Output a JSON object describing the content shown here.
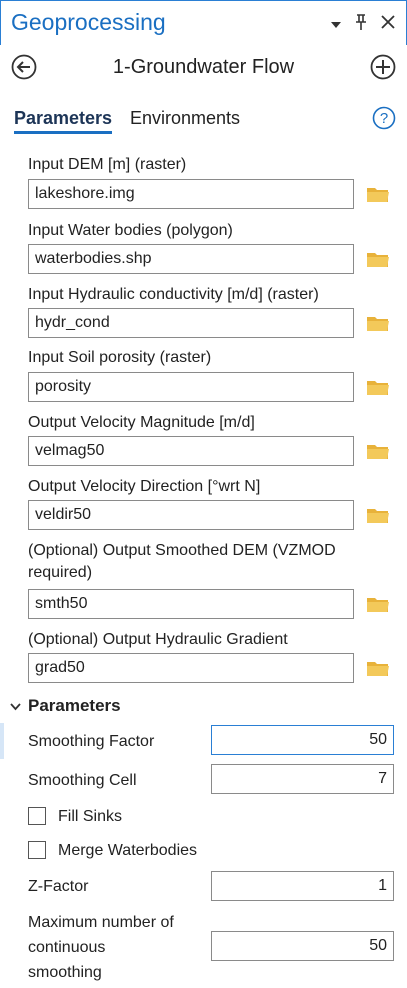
{
  "window": {
    "title": "Geoprocessing",
    "icons": [
      "chevron-down-icon",
      "pin-icon",
      "close-icon"
    ]
  },
  "nav": {
    "tool_name": "1-Groundwater Flow",
    "back_icon": "back-arrow-icon",
    "add_icon": "add-circle-icon"
  },
  "tabs": [
    {
      "label": "Parameters",
      "active": true
    },
    {
      "label": "Environments",
      "active": false
    }
  ],
  "help_glyph": "?",
  "params": [
    {
      "label": "Input DEM [m] (raster)",
      "value": "lakeshore.img"
    },
    {
      "label": "Input Water bodies (polygon)",
      "value": "waterbodies.shp"
    },
    {
      "label": "Input Hydraulic conductivity [m/d] (raster)",
      "value": "hydr_cond"
    },
    {
      "label": "Input Soil porosity (raster)",
      "value": "porosity"
    },
    {
      "label": "Output Velocity Magnitude [m/d]",
      "value": "velmag50"
    },
    {
      "label": "Output Velocity Direction [°wrt N]",
      "value": "veldir50"
    },
    {
      "label": "(Optional) Output Smoothed DEM (VZMOD required)",
      "value": "smth50"
    },
    {
      "label": "(Optional) Output Hydraulic Gradient",
      "value": "grad50"
    }
  ],
  "section": {
    "title": "Parameters",
    "smoothing_factor_label": "Smoothing Factor",
    "smoothing_factor_value": "50",
    "smoothing_cell_label": "Smoothing Cell",
    "smoothing_cell_value": "7",
    "fill_sinks_label": "Fill Sinks",
    "merge_waterbodies_label": "Merge Waterbodies",
    "z_factor_label": "Z-Factor",
    "z_factor_value": "1",
    "max_continuous_label_line1": "Maximum number of",
    "max_continuous_label_line2": "continuous",
    "max_continuous_label_line3": "smoothing",
    "max_continuous_value": "50"
  },
  "colors": {
    "accent": "#1a6fc2",
    "folder": "#e8b23a"
  }
}
